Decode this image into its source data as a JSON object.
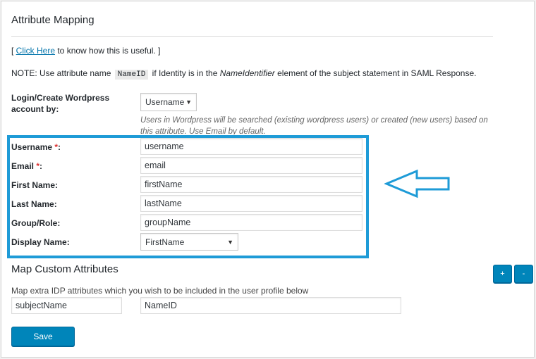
{
  "section": {
    "title": "Attribute Mapping",
    "help_prefix": "[ ",
    "help_link": "Click Here",
    "help_suffix": " to know how this is useful. ]",
    "note_label": "NOTE:",
    "note_part1": " Use attribute name ",
    "note_code": "NameID",
    "note_part2": " if Identity is in the ",
    "note_italic": "NameIdentifier",
    "note_part3": " element of the subject statement in SAML Response."
  },
  "login": {
    "label": "Login/Create Wordpress account by:",
    "selected": "Username",
    "description": "Users in Wordpress will be searched (existing wordpress users) or created (new users) based on this attribute. Use Email by default."
  },
  "fields": {
    "username": {
      "label": "Username ",
      "required_mark": "*",
      "colon": ":",
      "value": "username"
    },
    "email": {
      "label": "Email ",
      "required_mark": "*",
      "colon": ":",
      "value": "email"
    },
    "first_name": {
      "label": "First Name:",
      "value": "firstName"
    },
    "last_name": {
      "label": "Last Name:",
      "value": "lastName"
    },
    "group_role": {
      "label": "Group/Role:",
      "value": "groupName"
    },
    "display_name": {
      "label": "Display Name:",
      "selected": "FirstName"
    }
  },
  "custom": {
    "title": "Map Custom Attributes",
    "add_label": "+",
    "remove_label": "-",
    "description": "Map extra IDP attributes which you wish to be included in the user profile below",
    "name_value": "subjectName",
    "attr_value": "NameID"
  },
  "save_label": "Save",
  "colors": {
    "highlight": "#1e9bd7",
    "primary_button": "#0085ba",
    "required": "#dc3232"
  },
  "icons": {
    "dropdown": "triangle-down",
    "annotation_arrow": "left-arrow-outline"
  }
}
